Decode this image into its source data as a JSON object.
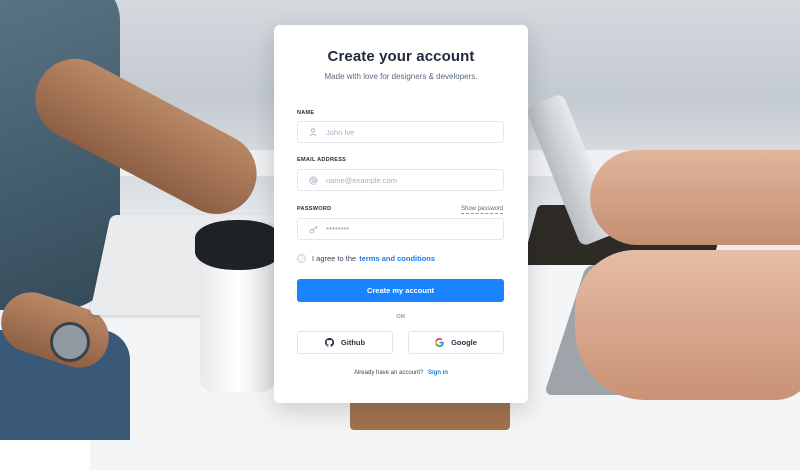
{
  "form": {
    "title": "Create your account",
    "subtitle": "Made with love for designers & developers.",
    "name_label": "NAME",
    "name_placeholder": "John Ive",
    "email_label": "EMAIL ADDRESS",
    "email_placeholder": "name@example.com",
    "password_label": "PASSWORD",
    "password_value": "********",
    "show_password": "Show password",
    "terms_prefix": "I agree to the",
    "terms_link": "terms and conditions",
    "submit_label": "Create my account",
    "or_label": "OR",
    "github_label": "Github",
    "google_label": "Google",
    "footer_text": "Already have an account?",
    "signin_link": "Sign in"
  },
  "colors": {
    "primary": "#1a84ff",
    "link": "#1e7ce8",
    "heading": "#1f2a3c"
  },
  "icons": {
    "name_field": "user-icon",
    "email_field": "at-icon",
    "password_field": "key-icon",
    "github": "github-icon",
    "google": "google-icon"
  }
}
